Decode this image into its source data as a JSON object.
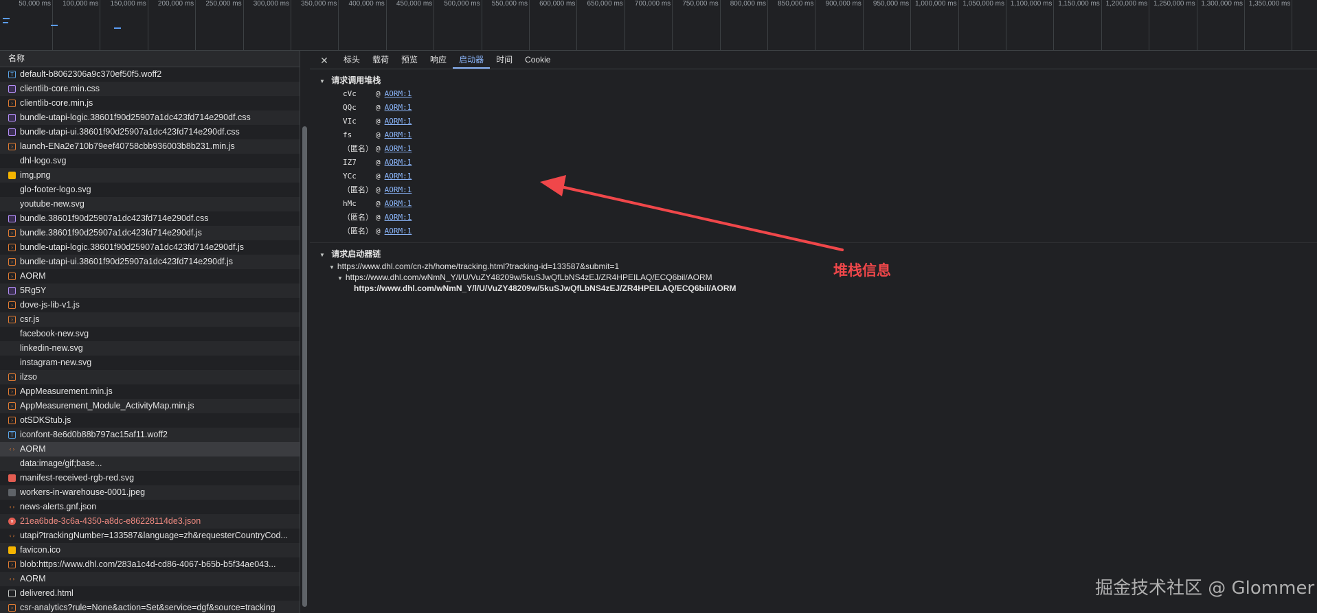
{
  "timeline": {
    "ticks": [
      "50,000 ms",
      "100,000 ms",
      "150,000 ms",
      "200,000 ms",
      "250,000 ms",
      "300,000 ms",
      "350,000 ms",
      "400,000 ms",
      "450,000 ms",
      "500,000 ms",
      "550,000 ms",
      "600,000 ms",
      "650,000 ms",
      "700,000 ms",
      "750,000 ms",
      "800,000 ms",
      "850,000 ms",
      "900,000 ms",
      "950,000 ms",
      "1,000,000 ms",
      "1,050,000 ms",
      "1,100,000 ms",
      "1,150,000 ms",
      "1,200,000 ms",
      "1,250,000 ms",
      "1,300,000 ms",
      "1,350,000 ms"
    ]
  },
  "request_list": {
    "column_header": "名称",
    "rows": [
      {
        "name": "default-b8062306a9c370ef50f5.woff2",
        "icon": "font-file-icon"
      },
      {
        "name": "clientlib-core.min.css",
        "icon": "css-file-icon"
      },
      {
        "name": "clientlib-core.min.js",
        "icon": "js-file-icon"
      },
      {
        "name": "bundle-utapi-logic.38601f90d25907a1dc423fd714e290df.css",
        "icon": "css-file-icon"
      },
      {
        "name": "bundle-utapi-ui.38601f90d25907a1dc423fd714e290df.css",
        "icon": "css-file-icon"
      },
      {
        "name": "launch-ENa2e710b79eef40758cbb936003b8b231.min.js",
        "icon": "js-file-icon"
      },
      {
        "name": "dhl-logo.svg",
        "icon": "svg-file-icon"
      },
      {
        "name": "img.png",
        "icon": "image-file-icon"
      },
      {
        "name": "glo-footer-logo.svg",
        "icon": "svg-file-icon"
      },
      {
        "name": "youtube-new.svg",
        "icon": "svg-file-icon"
      },
      {
        "name": "bundle.38601f90d25907a1dc423fd714e290df.css",
        "icon": "css-file-icon"
      },
      {
        "name": "bundle.38601f90d25907a1dc423fd714e290df.js",
        "icon": "js-file-icon"
      },
      {
        "name": "bundle-utapi-logic.38601f90d25907a1dc423fd714e290df.js",
        "icon": "js-file-icon"
      },
      {
        "name": "bundle-utapi-ui.38601f90d25907a1dc423fd714e290df.js",
        "icon": "js-file-icon"
      },
      {
        "name": "AORM",
        "icon": "js-file-icon"
      },
      {
        "name": "5Rg5Y",
        "icon": "css-file-icon"
      },
      {
        "name": "dove-js-lib-v1.js",
        "icon": "js-file-icon"
      },
      {
        "name": "csr.js",
        "icon": "js-file-icon"
      },
      {
        "name": "facebook-new.svg",
        "icon": "svg-file-icon"
      },
      {
        "name": "linkedin-new.svg",
        "icon": "svg-file-icon"
      },
      {
        "name": "instagram-new.svg",
        "icon": "svg-file-icon"
      },
      {
        "name": "ilzso",
        "icon": "js-file-icon"
      },
      {
        "name": "AppMeasurement.min.js",
        "icon": "js-file-icon"
      },
      {
        "name": "AppMeasurement_Module_ActivityMap.min.js",
        "icon": "js-file-icon"
      },
      {
        "name": "otSDKStub.js",
        "icon": "js-file-icon"
      },
      {
        "name": "iconfont-8e6d0b88b797ac15af11.woff2",
        "icon": "font-file-icon"
      },
      {
        "name": "AORM",
        "icon": "xhr-icon",
        "selected": true
      },
      {
        "name": "data:image/gif;base...",
        "icon": "blank-icon"
      },
      {
        "name": "manifest-received-rgb-red.svg",
        "icon": "red-svg-icon"
      },
      {
        "name": "workers-in-warehouse-0001.jpeg",
        "icon": "jpeg-file-icon"
      },
      {
        "name": "news-alerts.gnf.json",
        "icon": "xhr-icon"
      },
      {
        "name": "21ea6bde-3c6a-4350-a8dc-e86228114de3.json",
        "icon": "error-icon",
        "error": true
      },
      {
        "name": "utapi?trackingNumber=133587&language=zh&requesterCountryCod...",
        "icon": "xhr-icon"
      },
      {
        "name": "favicon.ico",
        "icon": "image-file-icon"
      },
      {
        "name": "blob:https://www.dhl.com/283a1c4d-cd86-4067-b65b-b5f34ae043...",
        "icon": "js-file-icon"
      },
      {
        "name": "AORM",
        "icon": "xhr-icon"
      },
      {
        "name": "delivered.html",
        "icon": "document-icon"
      },
      {
        "name": "csr-analytics?rule=None&action=Set&service=dgf&source=tracking",
        "icon": "js-file-icon"
      }
    ]
  },
  "detail": {
    "close_symbol": "✕",
    "tabs": [
      "标头",
      "载荷",
      "预览",
      "响应",
      "启动器",
      "时间",
      "Cookie"
    ],
    "active_tab_index": 4,
    "stack_section_title": "请求调用堆栈",
    "stack": [
      {
        "fn": "cVc",
        "at": "@",
        "loc": "AORM:1"
      },
      {
        "fn": "QQc",
        "at": "@",
        "loc": "AORM:1"
      },
      {
        "fn": "VIc",
        "at": "@",
        "loc": "AORM:1"
      },
      {
        "fn": "fs",
        "at": "@",
        "loc": "AORM:1"
      },
      {
        "fn": "（匿名）",
        "at": "@",
        "loc": "AORM:1"
      },
      {
        "fn": "IZ7",
        "at": "@",
        "loc": "AORM:1"
      },
      {
        "fn": "YCc",
        "at": "@",
        "loc": "AORM:1"
      },
      {
        "fn": "（匿名）",
        "at": "@",
        "loc": "AORM:1"
      },
      {
        "fn": "hMc",
        "at": "@",
        "loc": "AORM:1"
      },
      {
        "fn": "（匿名）",
        "at": "@",
        "loc": "AORM:1"
      },
      {
        "fn": "（匿名）",
        "at": "@",
        "loc": "AORM:1"
      }
    ],
    "chain_section_title": "请求启动器链",
    "chain": [
      {
        "level": 1,
        "text": "https://www.dhl.com/cn-zh/home/tracking.html?tracking-id=133587&submit=1"
      },
      {
        "level": 2,
        "text": "https://www.dhl.com/wNmN_Y/l/U/VuZY48209w/5kuSJwQfLbNS4zEJ/ZR4HPEILAQ/ECQ6bil/AORM"
      },
      {
        "level": 3,
        "text": "https://www.dhl.com/wNmN_Y/l/U/VuZY48209w/5kuSJwQfLbNS4zEJ/ZR4HPEILAQ/ECQ6bil/AORM"
      }
    ]
  },
  "annotation": {
    "label": "堆栈信息",
    "color": "#f0474a"
  },
  "watermark": "掘金技术社区 @ Glommer",
  "colors": {
    "accent": "#8ab4f8",
    "background": "#202124",
    "error": "#f28b82"
  }
}
